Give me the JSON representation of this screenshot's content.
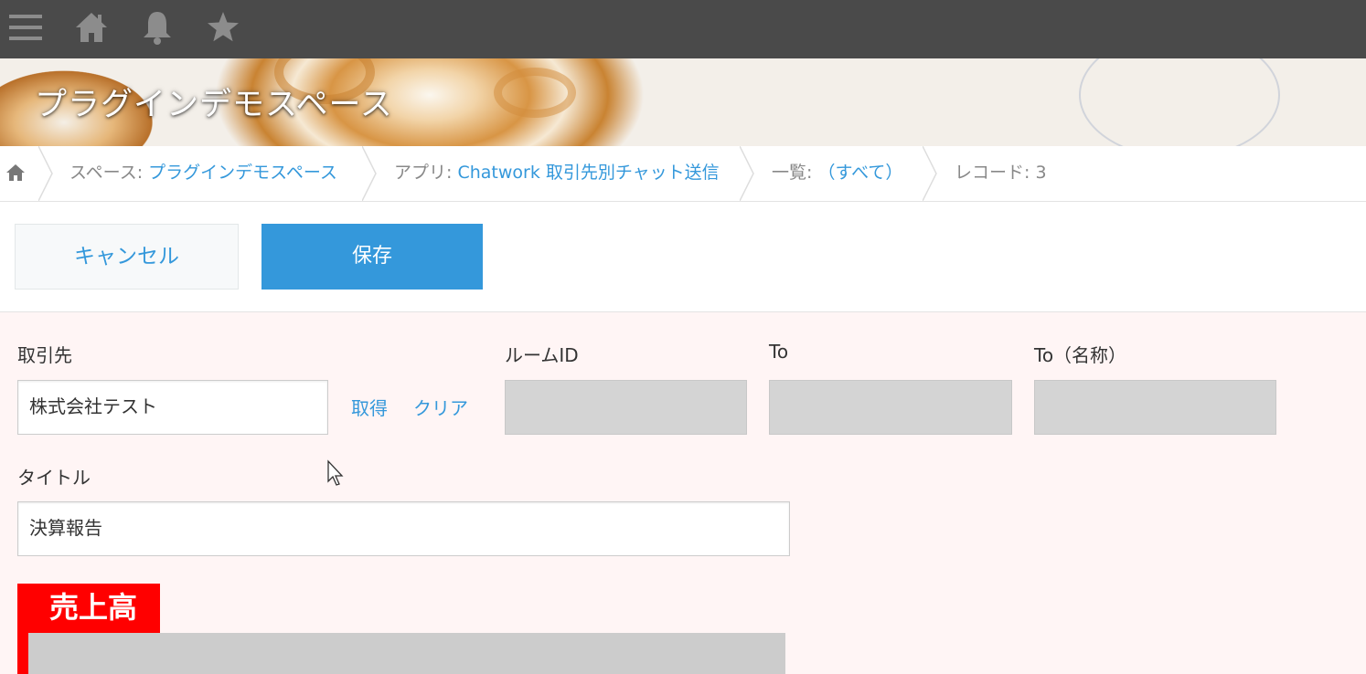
{
  "topbar": {
    "icons": [
      "menu-icon",
      "home-icon",
      "bell-icon",
      "star-icon"
    ]
  },
  "banner": {
    "title": "プラグインデモスペース"
  },
  "breadcrumb": {
    "home_icon": "home-icon",
    "space_label": "スペース:",
    "space_link": "プラグインデモスペース",
    "app_label": "アプリ:",
    "app_link": "Chatwork 取引先別チャット送信",
    "view_label": "一覧:",
    "view_link": "（すべて）",
    "record_label": "レコード: 3"
  },
  "toolbar": {
    "cancel_label": "キャンセル",
    "save_label": "保存"
  },
  "form": {
    "client": {
      "label": "取引先",
      "value": "株式会社テスト",
      "get_label": "取得",
      "clear_label": "クリア"
    },
    "room_id": {
      "label": "ルームID",
      "value": ""
    },
    "to": {
      "label": "To",
      "value": ""
    },
    "to_name": {
      "label": "To（名称）",
      "value": ""
    },
    "title": {
      "label": "タイトル",
      "value": "決算報告"
    },
    "sales": {
      "label": "売上高"
    }
  },
  "colors": {
    "topbar": "#4a4a4a",
    "accent": "#3498db",
    "form_bg": "#fff5f5",
    "readonly": "#d4d4d4",
    "sales_label": "#ff0000"
  }
}
